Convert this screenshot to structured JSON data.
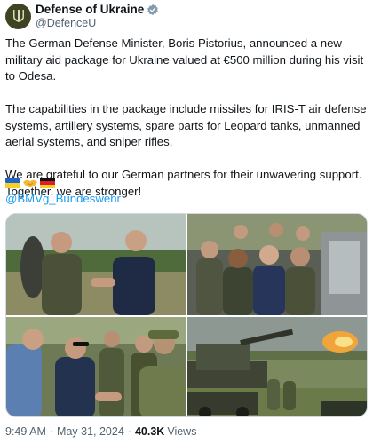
{
  "account": {
    "display_name": "Defense of Ukraine",
    "handle": "@DefenceU",
    "avatar_icon": "trident-icon",
    "verified_icon": "verified-badge-icon"
  },
  "tweet": {
    "paragraph1": "The German Defense Minister, Boris Pistorius, announced a new military aid package for Ukraine valued at €500 million during his visit to Odesa.",
    "paragraph2": "The capabilities in the package include missiles for IRIS-T air defense systems, artillery systems, spare parts for Leopard tanks, unmanned aerial systems, and sniper rifles.",
    "paragraph3": "We are grateful to our German partners for their unwavering support. Together, we are stronger!",
    "flags": [
      "ukraine-flag-emoji",
      "handshake-emoji",
      "germany-flag-emoji"
    ],
    "mention": "@BMVg_Bundeswehr"
  },
  "media": {
    "photos": [
      "handshake-photo",
      "officials-group-photo",
      "meeting-soldiers-photo",
      "air-defense-firing-photo"
    ]
  },
  "footer": {
    "time": "9:49 AM",
    "date": "May 31, 2024",
    "views_count": "40.3K",
    "views_label": "Views"
  },
  "colors": {
    "link": "#1d9bf0",
    "secondary_text": "#536471",
    "avatar_bg": "#3f4321",
    "verified": "#829aab"
  }
}
